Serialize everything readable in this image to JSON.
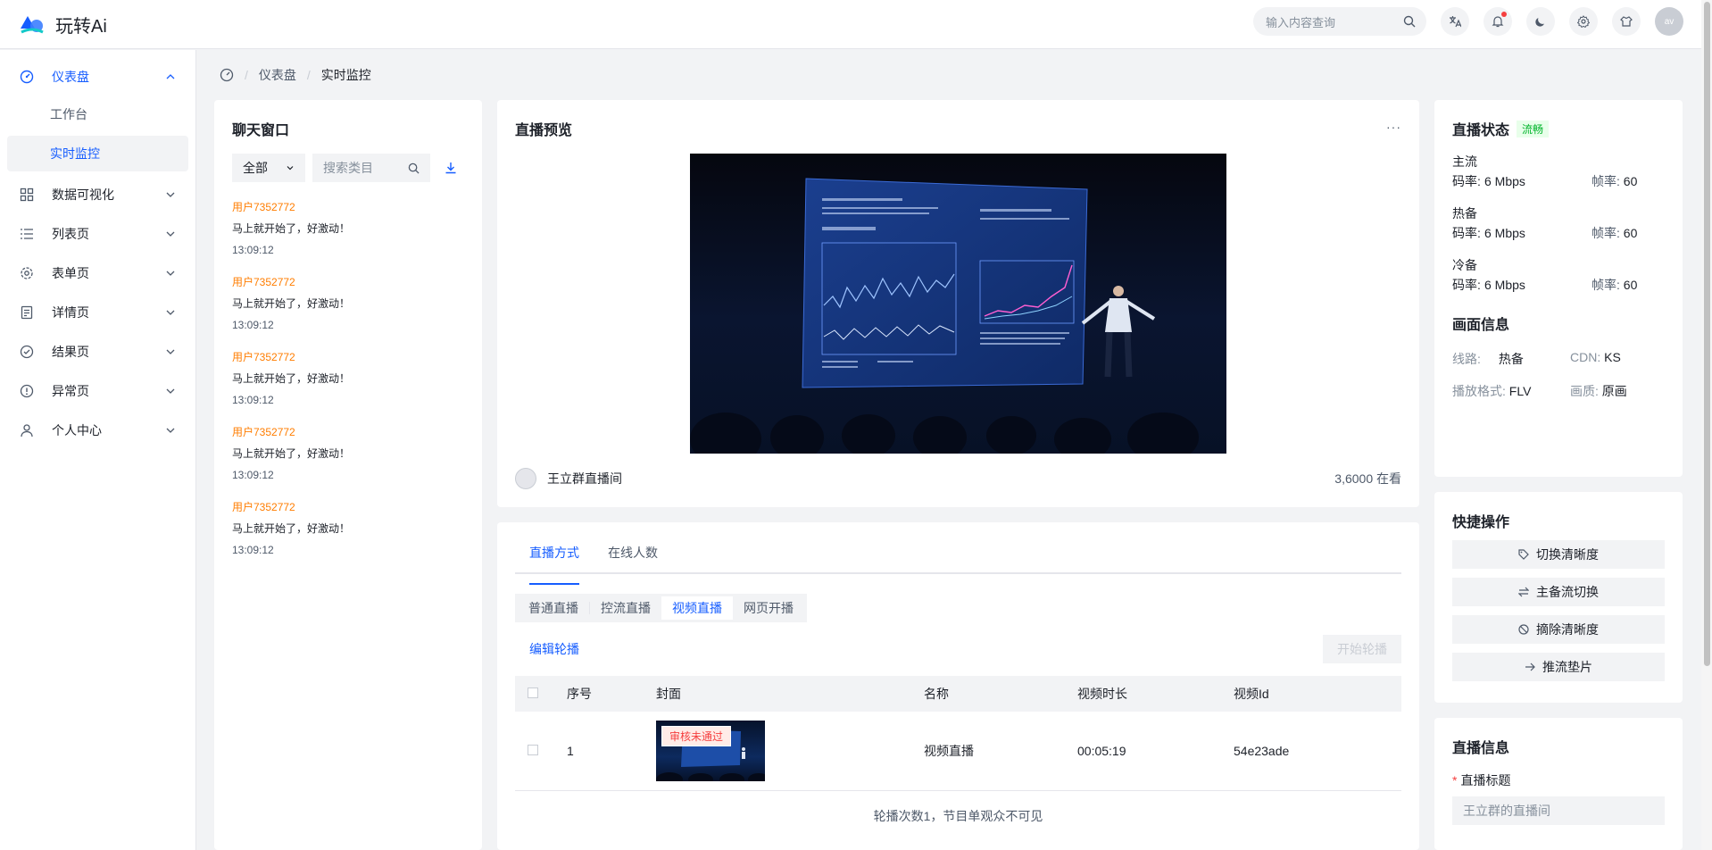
{
  "brand": {
    "name": "玩转Ai"
  },
  "top": {
    "search_placeholder": "输入内容查询",
    "avatar_alt": "av"
  },
  "sidebar": {
    "items": [
      {
        "label": "仪表盘",
        "icon": "dashboard-icon",
        "expanded": true
      },
      {
        "label": "数据可视化",
        "icon": "grid-icon"
      },
      {
        "label": "列表页",
        "icon": "list-icon"
      },
      {
        "label": "表单页",
        "icon": "gear-icon"
      },
      {
        "label": "详情页",
        "icon": "file-icon"
      },
      {
        "label": "结果页",
        "icon": "check-circle-icon"
      },
      {
        "label": "异常页",
        "icon": "exclamation-circle-icon"
      },
      {
        "label": "个人中心",
        "icon": "user-icon"
      }
    ],
    "sub_items": [
      {
        "label": "工作台"
      },
      {
        "label": "实时监控",
        "active": true
      }
    ]
  },
  "breadcrumb": {
    "level1": "仪表盘",
    "level2": "实时监控"
  },
  "chat": {
    "title": "聊天窗口",
    "filter_value": "全部",
    "search_placeholder": "搜索类目",
    "messages": [
      {
        "user": "用户7352772",
        "text": "马上就开始了，好激动！",
        "time": "13:09:12"
      },
      {
        "user": "用户7352772",
        "text": "马上就开始了，好激动！",
        "time": "13:09:12"
      },
      {
        "user": "用户7352772",
        "text": "马上就开始了，好激动！",
        "time": "13:09:12"
      },
      {
        "user": "用户7352772",
        "text": "马上就开始了，好激动！",
        "time": "13:09:12"
      },
      {
        "user": "用户7352772",
        "text": "马上就开始了，好激动！",
        "time": "13:09:12"
      }
    ]
  },
  "preview": {
    "title": "直播预览",
    "more": "···",
    "anchor_name": "王立群直播间",
    "viewers": "3,6000 在看"
  },
  "mode": {
    "tabs": [
      "直播方式",
      "在线人数"
    ],
    "segments": [
      "普通直播",
      "控流直播",
      "视频直播",
      "网页开播"
    ],
    "edit_label": "编辑轮播",
    "start_label": "开始轮播",
    "columns": [
      "序号",
      "封面",
      "名称",
      "视频时长",
      "视频Id"
    ],
    "rows": [
      {
        "index": "1",
        "badge": "审核未通过",
        "name": "视频直播",
        "duration": "00:05:19",
        "video_id": "54e23ade"
      }
    ],
    "footer": "轮播次数1，节目单观众不可见"
  },
  "status": {
    "title": "直播状态",
    "tag": "流畅",
    "streams": [
      {
        "label": "主流码率:",
        "bitrate": "6 Mbps",
        "fps_label": "帧率:",
        "fps": "60"
      },
      {
        "label": "热备码率:",
        "bitrate": "6 Mbps",
        "fps_label": "帧率:",
        "fps": "60"
      },
      {
        "label": "冷备码率:",
        "bitrate": "6 Mbps",
        "fps_label": "帧率:",
        "fps": "60"
      }
    ],
    "screen_title": "画面信息",
    "line_label": "线路:",
    "line_value": "热备",
    "cdn_label": "CDN:",
    "cdn_value": "KS",
    "format_label": "播放格式:",
    "format_value": "FLV",
    "quality_label": "画质:",
    "quality_value": "原画"
  },
  "quick": {
    "title": "快捷操作",
    "buttons": [
      {
        "label": "切换清晰度",
        "icon": "tag-icon"
      },
      {
        "label": "主备流切换",
        "icon": "swap-icon"
      },
      {
        "label": "摘除清晰度",
        "icon": "forbid-icon"
      },
      {
        "label": "推流垫片",
        "icon": "arrow-right-icon"
      }
    ]
  },
  "live_info": {
    "title": "直播信息",
    "field_label": "直播标题",
    "field_value": "王立群的直播间"
  },
  "colors": {
    "primary": "#165dff",
    "orange": "#ff7d00",
    "success": "#00b42a",
    "danger": "#f53f3f"
  }
}
